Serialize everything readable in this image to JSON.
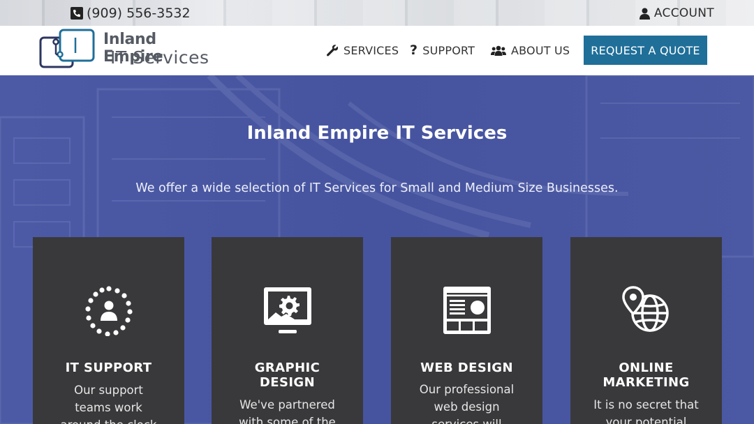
{
  "topbar": {
    "phone_icon": "phone-square-icon",
    "phone": "(909) 556-3532",
    "account_icon": "user-icon",
    "account": "ACCOUNT"
  },
  "header": {
    "logo_line1": "Inland Empire",
    "logo_line2": "IT Services",
    "nav": [
      {
        "label": "SERVICES",
        "icon": "wrench-icon"
      },
      {
        "label": "SUPPORT",
        "icon": "question-icon"
      },
      {
        "label": "ABOUT US",
        "icon": "users-icon"
      }
    ],
    "cta": "REQUEST A QUOTE"
  },
  "hero": {
    "title": "Inland Empire IT Services",
    "subtitle": "We offer a wide selection of IT Services for Small and Medium Size Businesses."
  },
  "cards": [
    {
      "icon": "support-person-icon",
      "title_line1": "IT SUPPORT",
      "title_line2": "",
      "text": [
        "Our support",
        "teams work",
        "around the clock"
      ]
    },
    {
      "icon": "monitor-gear-icon",
      "title_line1": "GRAPHIC",
      "title_line2": "DESIGN",
      "text": [
        "We've partnered",
        "with some of the"
      ]
    },
    {
      "icon": "browser-layout-icon",
      "title_line1": "WEB DESIGN",
      "title_line2": "",
      "text": [
        "Our professional",
        "web design",
        "services will"
      ]
    },
    {
      "icon": "location-globe-icon",
      "title_line1": "ONLINE",
      "title_line2": "MARKETING",
      "text": [
        "It is no secret that",
        "your potential"
      ]
    }
  ],
  "colors": {
    "brand_blue": "#1f6f99",
    "hero_overlay": "#4a57a2",
    "card_bg": "#39393b",
    "logo_gray": "#555a63",
    "logo_navy": "#2c3660"
  }
}
